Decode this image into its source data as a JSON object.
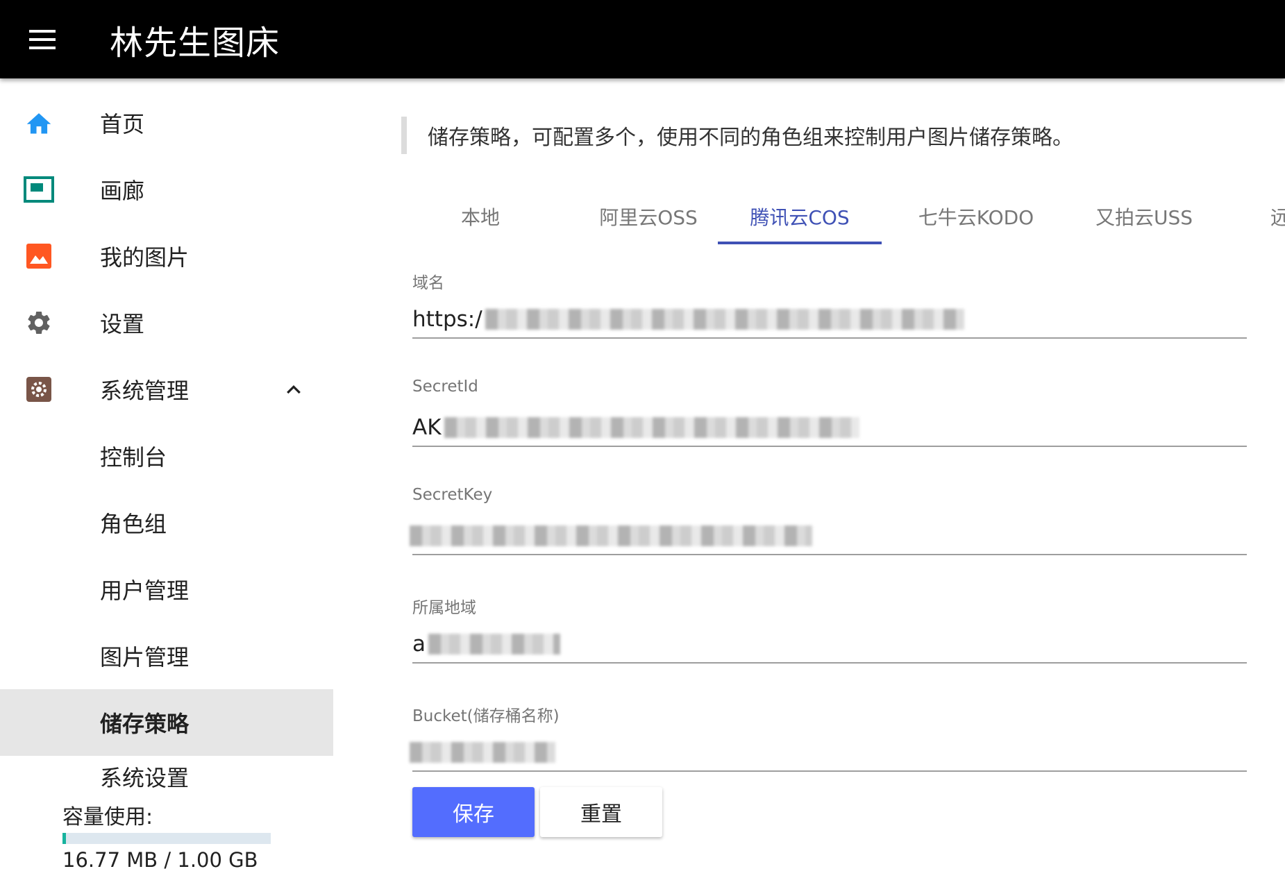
{
  "app": {
    "title": "林先生图床"
  },
  "sidebar": {
    "items": [
      {
        "label": "首页",
        "icon": "home-icon"
      },
      {
        "label": "画廊",
        "icon": "gallery-icon"
      },
      {
        "label": "我的图片",
        "icon": "image-icon"
      },
      {
        "label": "设置",
        "icon": "gear-icon"
      },
      {
        "label": "系统管理",
        "icon": "admin-settings-icon"
      }
    ],
    "admin_items": [
      {
        "label": "控制台"
      },
      {
        "label": "角色组"
      },
      {
        "label": "用户管理"
      },
      {
        "label": "图片管理"
      },
      {
        "label": "储存策略"
      },
      {
        "label": "系统设置"
      }
    ],
    "active_item": "储存策略",
    "storage": {
      "label": "容量使用:",
      "usage_text": "16.77 MB / 1.00 GB",
      "used_fraction": 0.016
    }
  },
  "main": {
    "notice": "储存策略，可配置多个，使用不同的角色组来控制用户图片储存策略。",
    "tabs": [
      {
        "label": "本地"
      },
      {
        "label": "阿里云OSS"
      },
      {
        "label": "腾讯云COS"
      },
      {
        "label": "七牛云KODO"
      },
      {
        "label": "又拍云USS"
      },
      {
        "label": "远"
      }
    ],
    "active_tab": "腾讯云COS",
    "fields": [
      {
        "label": "域名",
        "value": "https:/"
      },
      {
        "label": "SecretId",
        "value": "AK"
      },
      {
        "label": "SecretKey",
        "value": ""
      },
      {
        "label": "所属地域",
        "value": "a"
      },
      {
        "label": "Bucket(储存桶名称)",
        "value": ""
      }
    ],
    "buttons": {
      "save": "保存",
      "reset": "重置"
    }
  },
  "colors": {
    "appbar": "#000000",
    "accent": "#3f51b5",
    "primary_button": "#536dfe",
    "home_icon": "#2196f3",
    "gallery_icon": "#00897b",
    "image_icon": "#ff5722",
    "gear_icon": "#616161",
    "admin_icon": "#795548",
    "storage_fill": "#17b39e"
  }
}
